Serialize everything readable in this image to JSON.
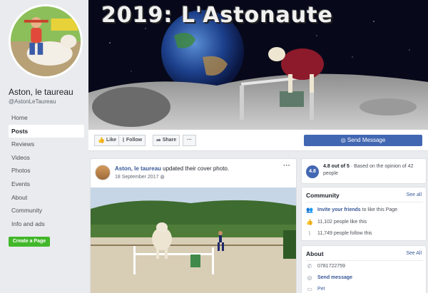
{
  "page": {
    "name": "Aston, le taureau",
    "handle": "@AstonLeTaureau"
  },
  "sidebar": {
    "items": [
      {
        "label": "Home",
        "active": false
      },
      {
        "label": "Posts",
        "active": true
      },
      {
        "label": "Reviews",
        "active": false
      },
      {
        "label": "Videos",
        "active": false
      },
      {
        "label": "Photos",
        "active": false
      },
      {
        "label": "Events",
        "active": false
      },
      {
        "label": "About",
        "active": false
      },
      {
        "label": "Community",
        "active": false
      },
      {
        "label": "Info and ads",
        "active": false
      }
    ],
    "create_page_label": "Create a Page"
  },
  "cover": {
    "title": "2019: L'Astonaute"
  },
  "actions": {
    "like_label": "Like",
    "follow_label": "Follow",
    "share_label": "Share",
    "more_label": "···",
    "send_message_label": "Send Message"
  },
  "post": {
    "author": "Aston, le taureau",
    "action_text": " updated their cover photo.",
    "date": "18 September 2017",
    "more_label": "···"
  },
  "rating": {
    "score": "4.8",
    "summary": "4.8 out of 5",
    "detail": " · Based on the opinion of 42 people"
  },
  "community": {
    "title": "Community",
    "see_all": "See all",
    "invite_link": "Invite your friends",
    "invite_rest": " to like this Page",
    "likes": "11,102 people like this",
    "follows": "11,749 people follow this"
  },
  "about": {
    "title": "About",
    "see_all": "See All",
    "phone": "0781722759",
    "send_message": "Send message",
    "category": "Pet"
  },
  "colors": {
    "brand_blue": "#4267b2",
    "link_blue": "#385898",
    "green_button": "#42b72a",
    "background": "#e9ebee"
  }
}
